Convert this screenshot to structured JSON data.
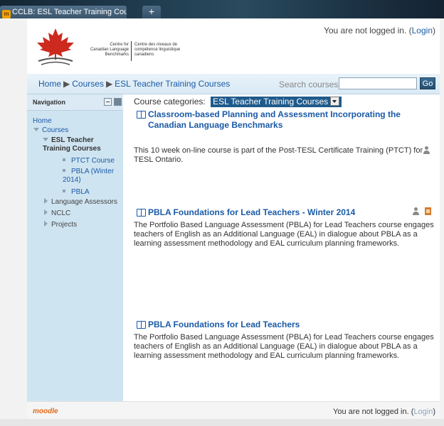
{
  "browser": {
    "tab_title": "CCLB: ESL Teacher Training Courses",
    "new_tab": "+"
  },
  "header": {
    "login_text": "You are not logged in. (",
    "login_link": "Login",
    "login_close": ")",
    "logo_en": [
      "Centre for",
      "Canadian Language",
      "Benchmarks"
    ],
    "logo_fr": [
      "Centre des niveaux de",
      "compétence linguistique",
      "canadiens"
    ]
  },
  "breadcrumb": {
    "items": [
      "Home",
      "Courses",
      "ESL Teacher Training Courses"
    ],
    "separator": "▶"
  },
  "search": {
    "label": "Search courses:",
    "value": "",
    "button": "Go"
  },
  "navigation": {
    "title": "Navigation",
    "items": [
      {
        "label": "Home"
      },
      {
        "label": "Courses"
      },
      {
        "label": "ESL Teacher Training Courses"
      },
      {
        "label": "PTCT Course"
      },
      {
        "label": "PBLA (Winter 2014)"
      },
      {
        "label": "PBLA"
      },
      {
        "label": "Language Assessors"
      },
      {
        "label": "NCLC"
      },
      {
        "label": "Projects"
      }
    ]
  },
  "main": {
    "category_label": "Course categories:",
    "category_value": "ESL Teacher Training Courses",
    "courses": [
      {
        "title": "Classroom-based Planning and Assessment Incorporating the Canadian Language Benchmarks",
        "description": "This 10 week on-line course is part of the Post-TESL Certificate Training (PTCT) for TESL Ontario."
      },
      {
        "title": "PBLA Foundations for Lead Teachers - Winter 2014",
        "description": "The Portfolio Based Language Assessment (PBLA) for Lead Teachers course engages teachers of English as an Additional Language (EAL) in dialogue about PBLA as a learning assessment methodology and EAL curriculum planning frameworks."
      },
      {
        "title": "PBLA Foundations for Lead Teachers",
        "description": "The Portfolio Based Language Assessment (PBLA) for Lead Teachers course engages teachers of English as an Additional Language (EAL) in dialogue about PBLA as a learning assessment methodology and EAL curriculum planning frameworks."
      }
    ]
  },
  "footer": {
    "moodle": "moodle",
    "login_text": "You are not logged in. (",
    "login_link": "Login",
    "login_close": ")"
  },
  "colors": {
    "link": "#1a5aa6",
    "sidebar_bg": "#cfe4f1",
    "logo_red": "#cc2a1e",
    "moodle_orange": "#e46a16"
  }
}
